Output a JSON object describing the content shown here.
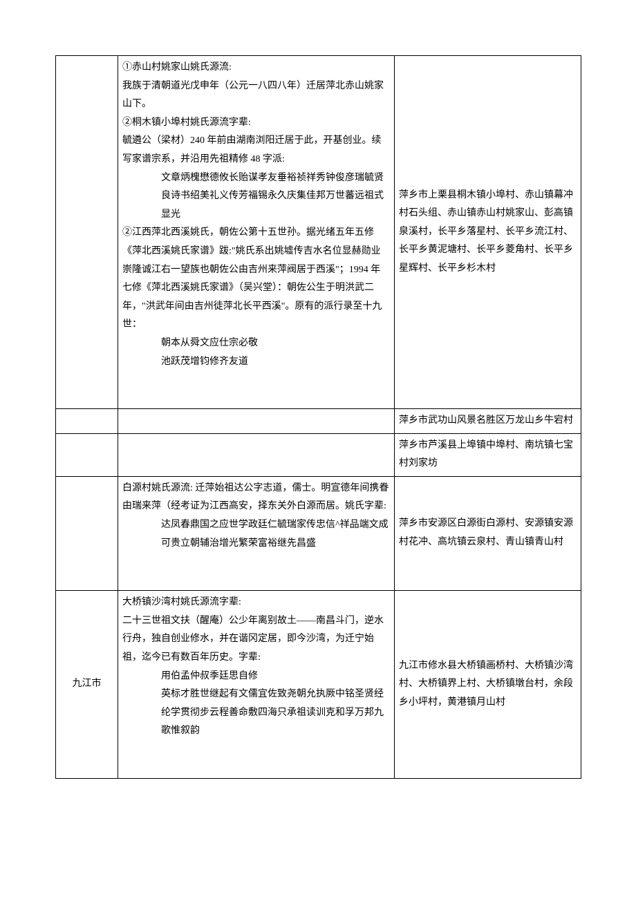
{
  "rows": [
    {
      "label": "",
      "source": {
        "l1": "①赤山村姚家山姚氏源流:",
        "l2": "我族于清朝道光戊申年（公元一八四八年）迁居萍北赤山姚家山下。",
        "l3": "②桐木镇小埠村姚氏源流字辈:",
        "l4": "毓遴公（梁材）240 年前由湖南浏阳迁居于此，开基创业。续写家谱宗系，并沿用先祖精修 48 字派:",
        "p1": "文章炳槐懋德攸长贻谋孝友垂裕祯祥秀钟俊彦瑞毓贤良诗书绍美礼义传芳福锡永久庆集佳邦万世蕃远祖式显光",
        "l5": "②江西萍北西溪姚氏，朝佐公第十五世孙。据光绪五年五修《萍北西溪姚氏家谱》跋:\"姚氏系出姚墟传吉水名位显赫勋业崇隆诚江右一望族也朝佐公由吉州来萍阀居于西溪\"；1994 年七修《萍北西溪姚氏家谱》（吴兴堂）：朝佐公生于明洪武二年，\"洪武年间由吉州徒萍北长平西溪\"。原有的派行录至十九世：",
        "p2": "朝本从舜文应仕宗必敬",
        "p3": "池跃茂增钧修齐友道"
      },
      "loc": "萍乡市上栗县桐木镇小埠村、赤山镇幕冲村石头组、赤山镇赤山村姚家山、彭高镇泉溪村，长平乡落星村、长平乡流江村、长平乡黄泥塘村、长平乡菱角村、长平乡星辉村、长平乡杉木村"
    },
    {
      "label": "",
      "source": "",
      "loc": "萍乡市武功山风景名胜区万龙山乡牛宕村"
    },
    {
      "label": "",
      "source": "",
      "loc": "萍乡市芦溪县上埠镇中埠村、南坑镇七宝村刘家坊"
    },
    {
      "label": "",
      "source": {
        "l1": "白源村姚氏源流: 迁萍始祖达公字志道，儒士。明宣德年间携眷由瑞来萍（经考证为江西高安，择东关外白源而居。姚氏字辈:",
        "p1": "达凤春鼎国之应世学政廷仁毓瑞家传忠信^祥品端文成可贵立朝辅治增光繁荣富裕继先昌盛"
      },
      "loc": "萍乡市安源区白源街白源村、安源镇安源村花冲、高坑镇云泉村、青山镇青山村"
    },
    {
      "label": "九江市",
      "source": {
        "l1": "大桥镇沙湾村姚氏源流字辈:",
        "l2": "二十三世祖文扶（醒庵）公少年离别故土——南昌斗门，逆水行舟，独自创业修水，并在谐冈定居，即今沙湾，为迁宁始祖，迄今已有数百年历史。字辈:",
        "p1": "用伯孟仲叔季廷思自修",
        "p2": "英标才胜世继起有文儒宜佐致尧朝允执厥中铭圣贤经纶学贯彻步云程善命敷四海只承祖读训克和孚万邦九歌惟叙韵"
      },
      "loc": "九江市修水县大桥镇画桥村、大桥镇沙湾村、大桥镇界上村、大桥镇墩台村，余段乡小坪村，黄港镇月山村"
    }
  ]
}
